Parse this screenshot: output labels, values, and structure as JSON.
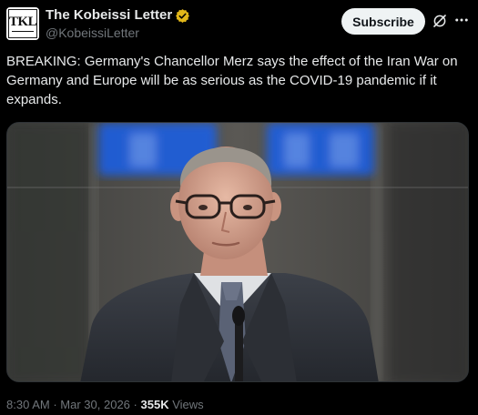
{
  "author": {
    "avatar_text": "TKL",
    "display_name": "The Kobeissi Letter",
    "handle": "@KobeissiLetter",
    "verified_badge_color": "#e2b719"
  },
  "actions": {
    "subscribe_label": "Subscribe",
    "grok_icon": "grok-icon",
    "more_icon": "more-horizontal-icon"
  },
  "tweet": {
    "text": "BREAKING: Germany's Chancellor Merz says the effect of the Iran War on Germany and Europe will be as serious as the COVID-19 pandemic if it expands."
  },
  "media": {
    "type": "photo",
    "background_sign_color": "#1f5fe0"
  },
  "meta": {
    "time": "8:30 AM",
    "separator": "·",
    "date": "Mar 30, 2026",
    "views_count": "355K",
    "views_label": "Views"
  },
  "colors": {
    "background": "#000000",
    "text_primary": "#e7e9ea",
    "text_secondary": "#71767b",
    "button_bg": "#eff3f4"
  }
}
